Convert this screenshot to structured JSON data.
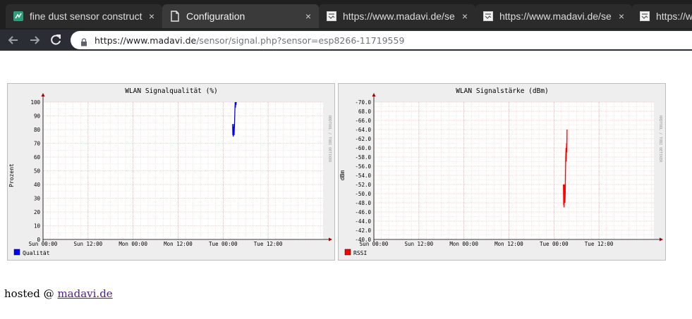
{
  "browser": {
    "tabs": [
      {
        "title": "fine dust sensor constructi",
        "icon": "sensor-community-icon",
        "active": false
      },
      {
        "title": "Configuration",
        "icon": "page-icon",
        "active": true
      },
      {
        "title": "https://www.madavi.de/se",
        "icon": "broken-image-icon",
        "active": false
      },
      {
        "title": "https://www.madavi.de/se",
        "icon": "broken-image-icon",
        "active": false
      },
      {
        "title": "https://w",
        "icon": "broken-image-icon",
        "active": false
      }
    ],
    "close_glyph": "×",
    "url_host": "https://www.madavi.de",
    "url_rest": "/sensor/signal.php?sensor=esp8266-11719559"
  },
  "charts": {
    "quality": {
      "title": "WLAN Signalqualität (%)",
      "ylabel": "Prozent",
      "legend": "Qualität",
      "legend_color": "#0000ff",
      "side_label": "RRDTOOL / TOBI OETIKER"
    },
    "strength": {
      "title": "WLAN Signalstärke (dBm)",
      "ylabel": "dBm",
      "legend": "RSSI",
      "legend_color": "#ff0000",
      "side_label": "RRDTOOL / TOBI OETIKER"
    }
  },
  "chart_data": [
    {
      "type": "line",
      "title": "WLAN Signalqualität (%)",
      "ylabel": "Prozent",
      "ylim": [
        0,
        100
      ],
      "yticks": [
        "0",
        "10",
        "20",
        "30",
        "40",
        "50",
        "60",
        "70",
        "80",
        "90",
        "100"
      ],
      "xticks": [
        "Sun 00:00",
        "Sun 12:00",
        "Mon 00:00",
        "Mon 12:00",
        "Tue 00:00",
        "Tue 12:00"
      ],
      "xlim": [
        0,
        3.11
      ],
      "grid": true,
      "legend_position": "bottom-left",
      "series": [
        {
          "name": "Qualität",
          "color": "#0000ff",
          "x": [
            2.105,
            2.108,
            2.11,
            2.113,
            2.116,
            2.119,
            2.122,
            2.125,
            2.128,
            2.131,
            2.134,
            2.137,
            2.14,
            2.143,
            2.146
          ],
          "y": [
            84,
            76,
            82,
            75,
            78,
            84,
            76,
            82,
            86,
            94,
            100,
            96,
            100,
            98,
            100
          ]
        }
      ]
    },
    {
      "type": "line",
      "title": "WLAN Signalstärke (dBm)",
      "ylabel": "dBm",
      "ylim": [
        -70,
        -40
      ],
      "yticks": [
        "-40.0",
        "-42.0",
        "-44.0",
        "-46.0",
        "-48.0",
        "-50.0",
        "-52.0",
        "-54.0",
        "-56.0",
        "-58.0",
        "-60.0",
        "-62.0",
        "-64.0",
        "-66.0",
        "68.0",
        "-70.0"
      ],
      "xticks": [
        "Sun 00:00",
        "Sun 12:00",
        "Mon 00:00",
        "Mon 12:00",
        "Tue 00:00",
        "Tue 12:00"
      ],
      "xlim": [
        0,
        3.11
      ],
      "grid": true,
      "legend_position": "bottom-left",
      "series": [
        {
          "name": "RSSI",
          "color": "#ff0000",
          "x": [
            2.105,
            2.108,
            2.11,
            2.113,
            2.116,
            2.119,
            2.122,
            2.125,
            2.128,
            2.131,
            2.134,
            2.137,
            2.14,
            2.143,
            2.146
          ],
          "y": [
            -58,
            -62.5,
            -58,
            -63,
            -61,
            -58,
            -62,
            -60,
            -56,
            -52,
            -50,
            -53,
            -49,
            -51,
            -46
          ]
        }
      ]
    }
  ],
  "footer": {
    "text": "hosted @ ",
    "link": "madavi.de"
  }
}
